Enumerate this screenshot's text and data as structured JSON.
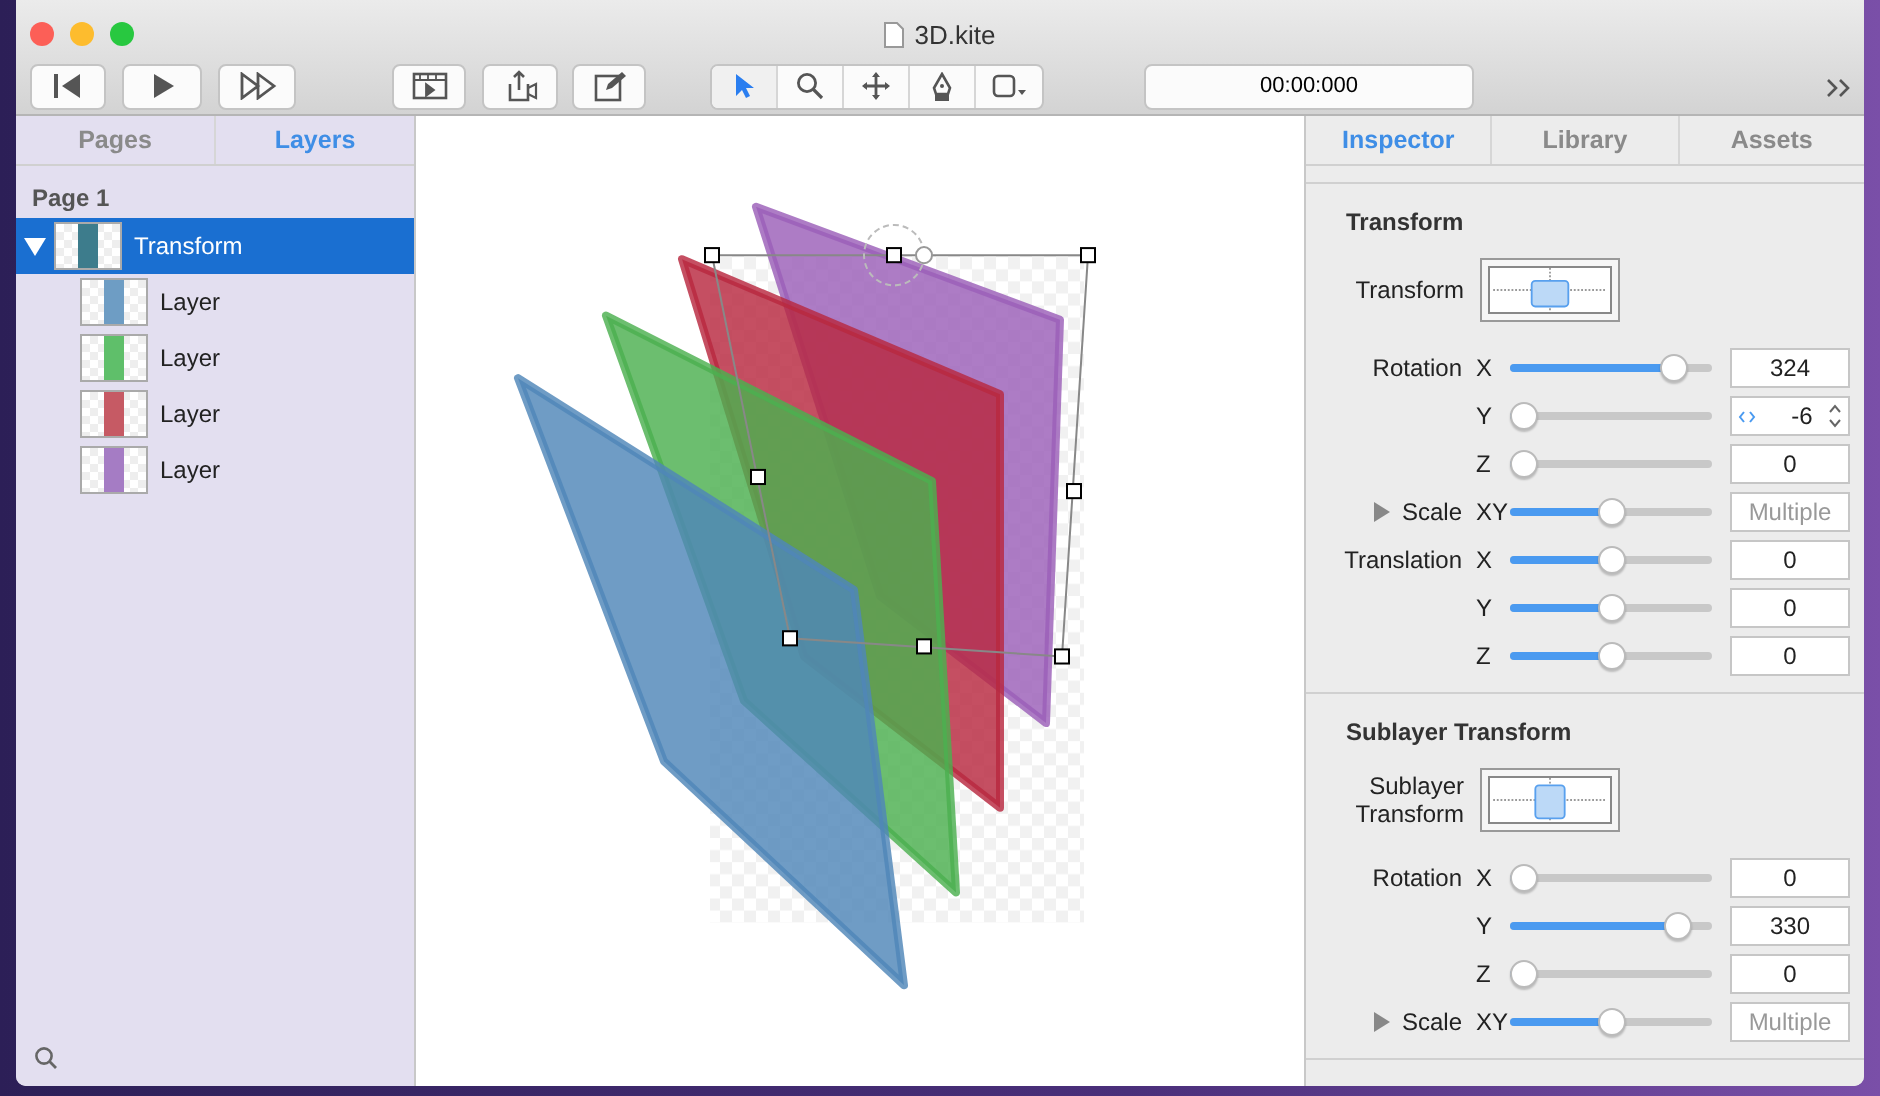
{
  "window": {
    "title": "3D.kite"
  },
  "toolbar": {
    "tools": [
      {
        "selected": true
      },
      {
        "selected": false
      },
      {
        "selected": false
      },
      {
        "selected": false
      },
      {
        "selected": false
      }
    ],
    "timecode": "00:00:000"
  },
  "left_tabs": [
    {
      "label": "Pages",
      "selected": false
    },
    {
      "label": "Layers",
      "selected": true
    }
  ],
  "page_label": "Page 1",
  "layers": [
    {
      "name": "Transform",
      "selected": true,
      "expanded": true,
      "color": "#3d7c8c",
      "children": [
        {
          "name": "Layer",
          "selected": false,
          "color": "#6e9dc4"
        },
        {
          "name": "Layer",
          "selected": false,
          "color": "#5fbf6a"
        },
        {
          "name": "Layer",
          "selected": false,
          "color": "#c65a64"
        },
        {
          "name": "Layer",
          "selected": false,
          "color": "#a57cc4"
        }
      ]
    }
  ],
  "right_tabs": [
    {
      "label": "Inspector",
      "selected": true
    },
    {
      "label": "Library",
      "selected": false
    },
    {
      "label": "Assets",
      "selected": false
    }
  ],
  "sections": [
    {
      "title": "Transform",
      "preview_label": "Transform",
      "rows": [
        {
          "kind": "number",
          "group": "Rotation",
          "axis": "X",
          "level": 0.86,
          "value": "324"
        },
        {
          "kind": "stepper",
          "axis": "Y",
          "level": 0,
          "value": "-6"
        },
        {
          "kind": "number",
          "axis": "Z",
          "level": 0,
          "value": "0"
        },
        {
          "kind": "disclosure",
          "expanded": false,
          "group": "Scale",
          "axis": "XY",
          "level": 0.5,
          "placeholder": "Multiple"
        },
        {
          "kind": "number",
          "group": "Translation",
          "axis": "X",
          "level": 0.5,
          "value": "0"
        },
        {
          "kind": "number",
          "axis": "Y",
          "level": 0.5,
          "value": "0"
        },
        {
          "kind": "number",
          "axis": "Z",
          "level": 0.5,
          "value": "0"
        }
      ]
    },
    {
      "title": "Sublayer Transform",
      "preview_label": "Sublayer Transform",
      "rows": [
        {
          "kind": "number",
          "group": "Rotation",
          "axis": "X",
          "level": 0,
          "value": "0"
        },
        {
          "kind": "number",
          "axis": "Y",
          "level": 0.88,
          "value": "330"
        },
        {
          "kind": "number",
          "axis": "Z",
          "level": 0,
          "value": "0"
        },
        {
          "kind": "disclosure",
          "expanded": false,
          "group": "Scale",
          "axis": "XY",
          "level": 0.5,
          "placeholder": "Multiple"
        }
      ]
    }
  ]
}
